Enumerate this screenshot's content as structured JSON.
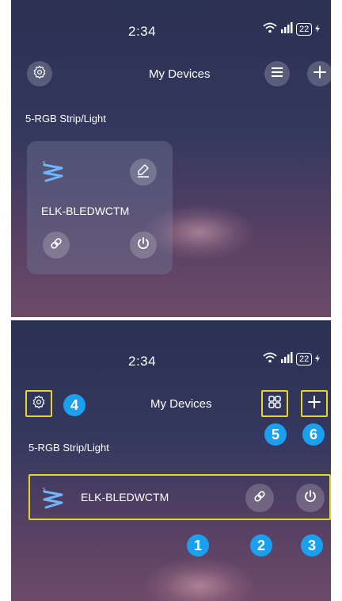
{
  "screens": [
    {
      "status_bar": {
        "time": "2:34",
        "battery": "22"
      },
      "header": {
        "title": "My Devices"
      },
      "section_label": "5-RGB Strip/Light",
      "device": {
        "name": "ELK-BLEDWCTM"
      }
    },
    {
      "status_bar": {
        "time": "2:34",
        "battery": "22"
      },
      "header": {
        "title": "My Devices"
      },
      "section_label": "5-RGB Strip/Light",
      "device": {
        "name": "ELK-BLEDWCTM"
      },
      "callouts": [
        "1",
        "2",
        "3",
        "4",
        "5",
        "6"
      ]
    }
  ],
  "icons": {
    "settings": "gear-icon",
    "list_view": "list-icon",
    "grid_view": "grid-icon",
    "add": "plus-icon",
    "edit": "pencil-icon",
    "link": "link-icon",
    "power": "power-icon",
    "strip": "led-strip-icon"
  },
  "colors": {
    "callout_badge": "#1ba0ef",
    "highlight_box": "#e6d62a"
  }
}
